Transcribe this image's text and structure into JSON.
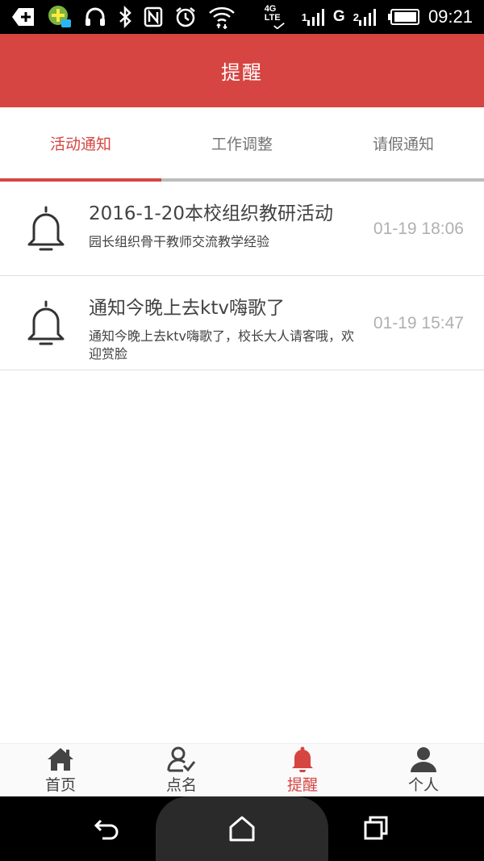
{
  "status_bar": {
    "time": "09:21",
    "network_label": "4G LTE",
    "carrier_g": "G",
    "signal_2": "2",
    "signal_1": "1",
    "icons": [
      "add-icon",
      "app-notification-icon",
      "headset-icon",
      "bluetooth-icon",
      "nfc-icon",
      "alarm-icon",
      "wifi-icon",
      "signal-icon",
      "battery-icon"
    ]
  },
  "header": {
    "title": "提醒"
  },
  "tabs": [
    {
      "label": "活动通知",
      "active": true
    },
    {
      "label": "工作调整",
      "active": false
    },
    {
      "label": "请假通知",
      "active": false
    }
  ],
  "notifications": [
    {
      "title": "2016-1-20本校组织教研活动",
      "description": "园长组织骨干教师交流教学经验",
      "time": "01-19 18:06",
      "icon": "bell-icon"
    },
    {
      "title": "通知今晚上去ktv嗨歌了",
      "description": "通知今晚上去ktv嗨歌了，校长大人请客哦，欢迎赏脸",
      "time": "01-19 15:47",
      "icon": "bell-icon"
    }
  ],
  "bottom_nav": [
    {
      "label": "首页",
      "icon": "home-icon",
      "active": false
    },
    {
      "label": "点名",
      "icon": "roll-call-icon",
      "active": false
    },
    {
      "label": "提醒",
      "icon": "bell-icon",
      "active": true
    },
    {
      "label": "个人",
      "icon": "person-icon",
      "active": false
    }
  ],
  "colors": {
    "accent": "#d64541",
    "text": "#424242",
    "muted": "#b0b0b0"
  }
}
